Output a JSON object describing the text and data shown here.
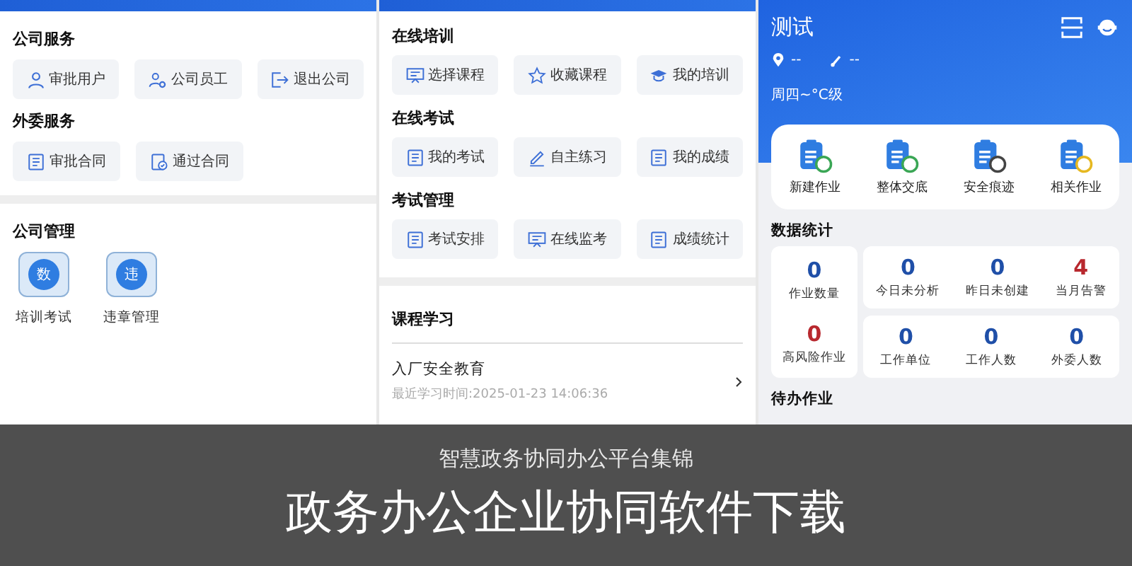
{
  "left_panel": {
    "sections": [
      {
        "title": "公司服务",
        "items": [
          "审批用户",
          "公司员工",
          "退出公司"
        ]
      },
      {
        "title": "外委服务",
        "items": [
          "审批合同",
          "通过合同"
        ]
      }
    ],
    "management": {
      "title": "公司管理",
      "items": [
        {
          "label": "培训考试",
          "badge": "数"
        },
        {
          "label": "违章管理",
          "badge": "违"
        }
      ]
    }
  },
  "middle_panel": {
    "sections": [
      {
        "title": "在线培训",
        "items": [
          "选择课程",
          "收藏课程",
          "我的培训"
        ]
      },
      {
        "title": "在线考试",
        "items": [
          "我的考试",
          "自主练习",
          "我的成绩"
        ]
      },
      {
        "title": "考试管理",
        "items": [
          "考试安排",
          "在线监考",
          "成绩统计"
        ]
      }
    ],
    "courses": {
      "title": "课程学习",
      "items": [
        {
          "name": "入厂安全教育",
          "time": "最近学习时间:2025-01-23 14:06:36"
        }
      ]
    }
  },
  "right_panel": {
    "title": "测试",
    "location": "--",
    "weather": "--",
    "forecast": "周四~°C级",
    "actions": [
      "新建作业",
      "整体交底",
      "安全痕迹",
      "相关作业"
    ],
    "stats_title": "数据统计",
    "stat_cards": [
      {
        "kind": "column",
        "stats": [
          {
            "value": "0",
            "label": "作业数量",
            "color": "#1f4fa8"
          },
          {
            "value": "0",
            "label": "高风险作业",
            "color": "#b8282e"
          }
        ]
      },
      {
        "kind": "row",
        "stats": [
          {
            "value": "0",
            "label": "今日未分析",
            "color": "#1f4fa8"
          },
          {
            "value": "0",
            "label": "昨日未创建",
            "color": "#1f4fa8"
          },
          {
            "value": "4",
            "label": "当月告警",
            "color": "#b8282e"
          }
        ]
      },
      {
        "kind": "row",
        "stats": [
          {
            "value": "0",
            "label": "工作单位",
            "color": "#1f4fa8"
          },
          {
            "value": "0",
            "label": "工作人数",
            "color": "#1f4fa8"
          },
          {
            "value": "0",
            "label": "外委人数",
            "color": "#1f4fa8"
          }
        ]
      }
    ],
    "pending_title": "待办作业"
  },
  "banner": {
    "subtitle": "智慧政务协同办公平台集锦",
    "title": "政务办公企业协同软件下载"
  }
}
